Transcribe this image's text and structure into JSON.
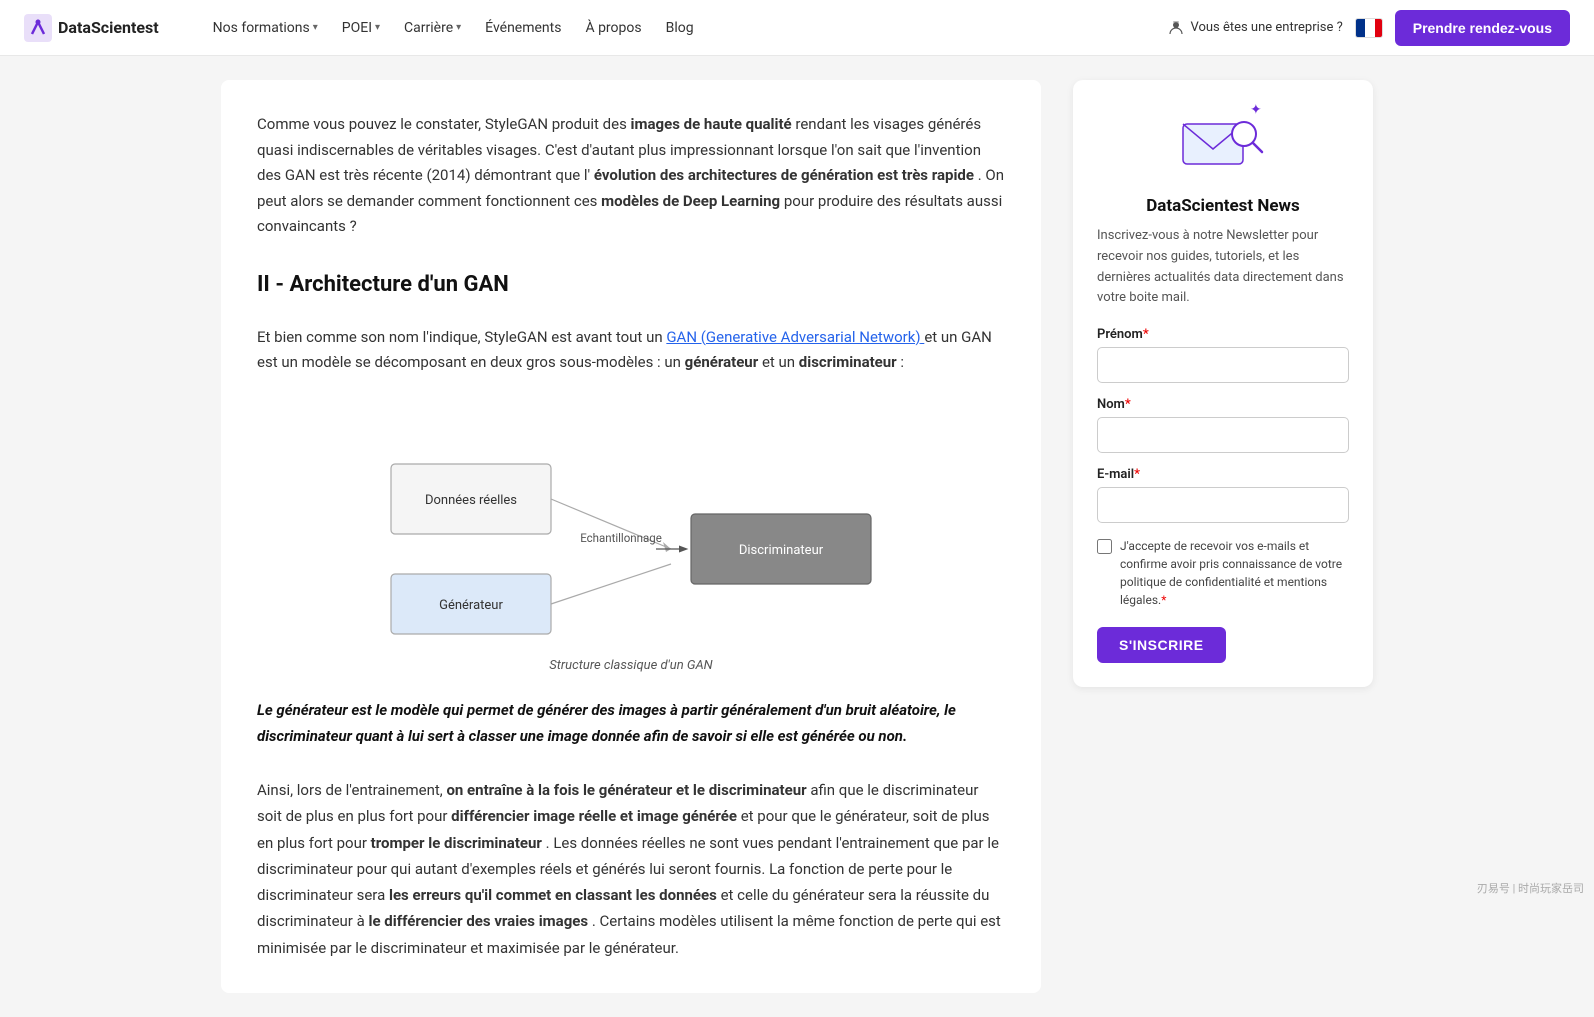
{
  "navbar": {
    "logo_text": "DataScientest",
    "nav_items": [
      {
        "label": "Nos formations",
        "has_dropdown": true
      },
      {
        "label": "POEI",
        "has_dropdown": true
      },
      {
        "label": "Carrière",
        "has_dropdown": true
      },
      {
        "label": "Événements",
        "has_dropdown": false
      },
      {
        "label": "À propos",
        "has_dropdown": false
      },
      {
        "label": "Blog",
        "has_dropdown": false
      }
    ],
    "enterprise_label": "Vous êtes une entreprise ?",
    "cta_label": "Prendre rendez-vous"
  },
  "main": {
    "intro_paragraph_1": "Comme vous pouvez le constater, StyleGAN produit des ",
    "intro_bold_1": "images de haute qualité",
    "intro_paragraph_2": " rendant les visages générés quasi indiscernables de véritables visages. C'est d'autant plus impressionnant lorsque l'on sait que l'invention des GAN est très récente (2014) démontrant que l'",
    "intro_bold_2": "évolution des architectures de génération est très rapide",
    "intro_paragraph_3": ". On peut alors se demander comment fonctionnent ces ",
    "intro_bold_3": "modèles de Deep Learning",
    "intro_paragraph_4": " pour produire des résultats aussi convaincants ?",
    "section_title": "II - Architecture d'un GAN",
    "section_paragraph_1": "Et bien comme son nom l'indique, StyleGAN est avant tout un ",
    "section_link": "GAN (Generative Adversarial Network)",
    "section_paragraph_2": " et un GAN est un modèle se décomposant en deux gros sous-modèles : un ",
    "section_bold_1": "générateur",
    "section_paragraph_3": " et un ",
    "section_bold_2": "discriminateur",
    "section_paragraph_4": " :",
    "diagram_caption": "Structure classique d'un GAN",
    "diagram": {
      "box1_label": "Données réelles",
      "box2_label": "Générateur",
      "box3_label": "Echantillonnage",
      "box4_label": "Discriminateur"
    },
    "blockquote": "Le générateur est le modèle qui permet de générer des images à partir généralement d'un bruit aléatoire, le discriminateur quant à lui sert à classer une image donnée afin de savoir si elle est générée ou non.",
    "bottom_p1": "Ainsi, lors de l'entrainement, ",
    "bottom_bold_1": "on entraîne à la fois le générateur et le discriminateur",
    "bottom_p2": " afin que le discriminateur soit de plus en plus fort pour ",
    "bottom_bold_2": "différencier image réelle et image générée",
    "bottom_p3": " et pour que le générateur, soit de plus en plus fort pour ",
    "bottom_bold_3": "tromper le discriminateur",
    "bottom_p4": ". Les données réelles ne sont vues pendant l'entrainement que par le discriminateur pour qui autant d'exemples réels et générés lui seront fournis. La fonction de perte pour le discriminateur sera ",
    "bottom_bold_4": "les erreurs qu'il commet en classant les données",
    "bottom_p5": " et celle du générateur sera la réussite du discriminateur à ",
    "bottom_bold_5": "le différencier des vraies images",
    "bottom_p6": ". Certains modèles utilisent la même fonction de perte qui est minimisée par le discriminateur et maximisée par le générateur."
  },
  "sidebar": {
    "title": "DataScientest News",
    "description": "Inscrivez-vous à notre Newsletter pour recevoir nos guides, tutoriels, et les dernières actualités data directement dans votre boite mail.",
    "form": {
      "prenom_label": "Prénom",
      "prenom_required": "*",
      "prenom_placeholder": "",
      "nom_label": "Nom",
      "nom_required": "*",
      "nom_placeholder": "",
      "email_label": "E-mail",
      "email_required": "*",
      "email_placeholder": "",
      "checkbox_label": "J'accepte de recevoir vos e-mails et confirme avoir pris connaissance de votre politique de confidentialité et mentions légales.",
      "checkbox_required": "*",
      "submit_label": "S'INSCRIRE"
    }
  },
  "watermark": "刃易号 | 时尚玩家岳司"
}
